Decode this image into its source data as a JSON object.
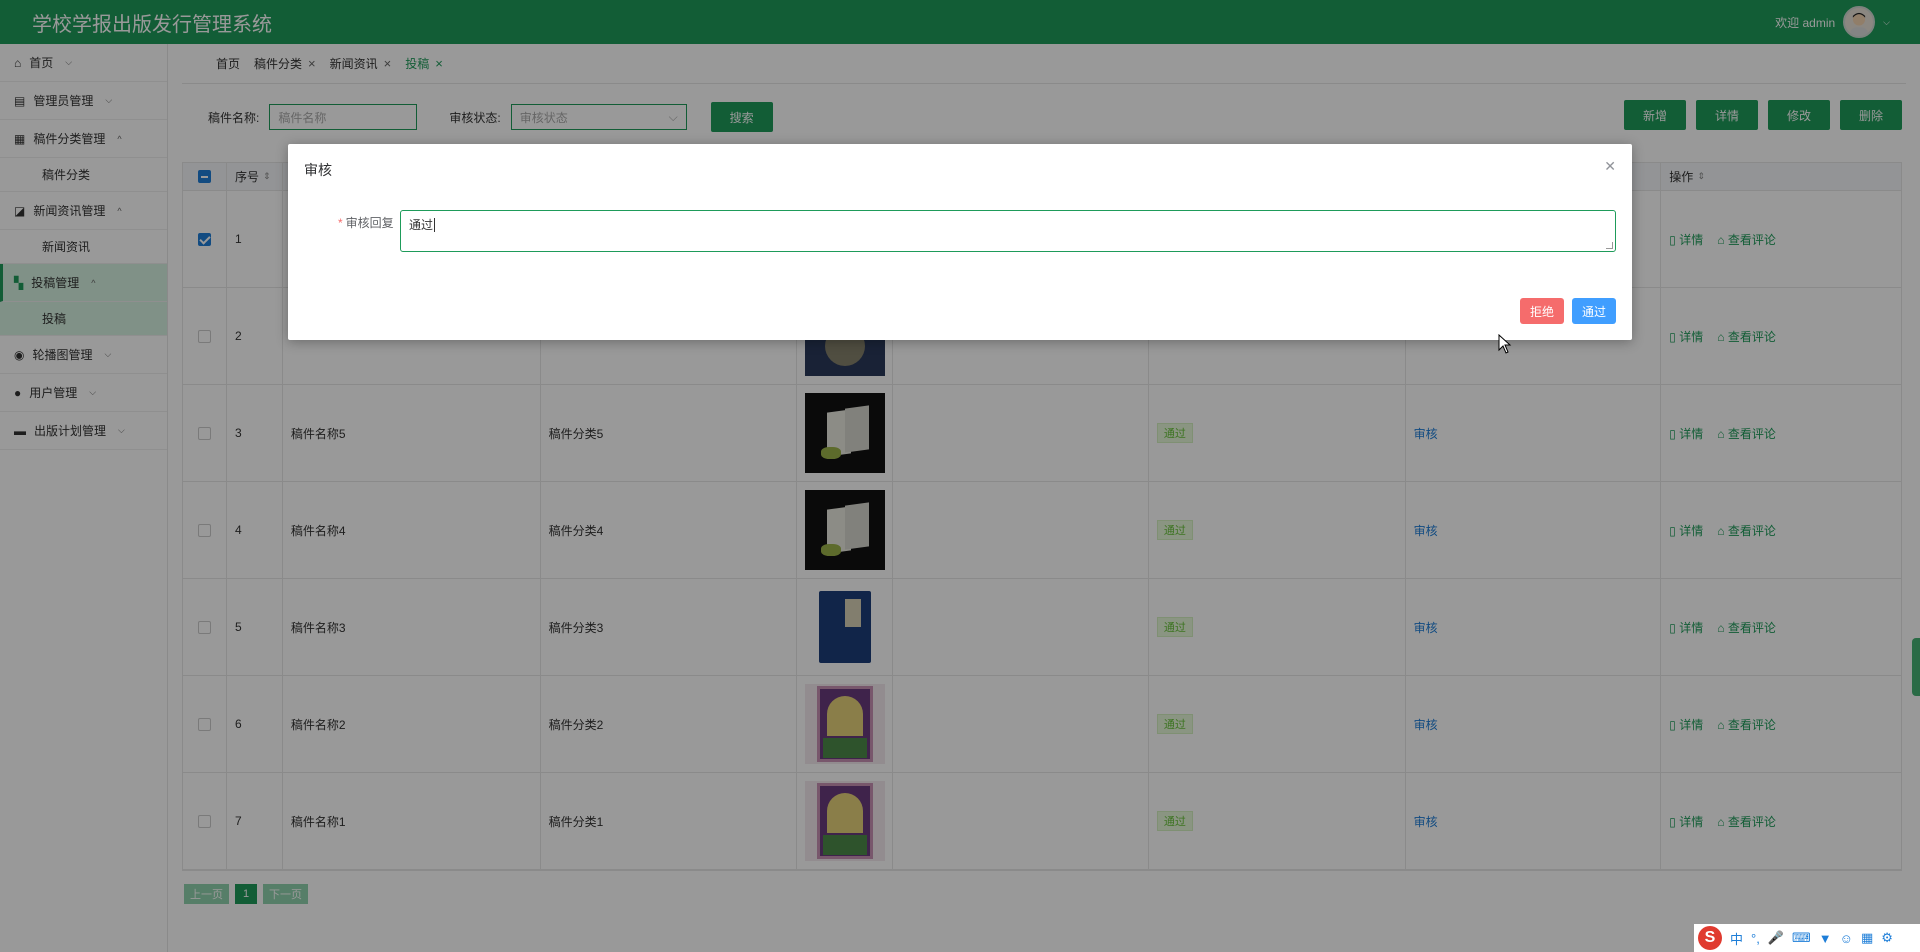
{
  "header": {
    "title": "学校学报出版发行管理系统",
    "welcome": "欢迎 admin"
  },
  "sidebar": {
    "items": [
      {
        "label": "首页",
        "icon": "home-icon"
      },
      {
        "label": "管理员管理",
        "icon": "server-icon"
      },
      {
        "label": "稿件分类管理",
        "icon": "grid-icon",
        "sub": "稿件分类"
      },
      {
        "label": "新闻资讯管理",
        "icon": "chart-icon",
        "sub": "新闻资讯"
      },
      {
        "label": "投稿管理",
        "icon": "dashboard-icon",
        "sub": "投稿"
      },
      {
        "label": "轮播图管理",
        "icon": "record-icon"
      },
      {
        "label": "用户管理",
        "icon": "user-icon"
      },
      {
        "label": "出版计划管理",
        "icon": "folder-icon"
      }
    ]
  },
  "tabs": [
    {
      "label": "首页"
    },
    {
      "label": "稿件分类"
    },
    {
      "label": "新闻资讯"
    },
    {
      "label": "投稿"
    }
  ],
  "search": {
    "name_label": "稿件名称:",
    "name_placeholder": "稿件名称",
    "status_label": "审核状态:",
    "status_placeholder": "审核状态",
    "search_button": "搜索"
  },
  "actions": {
    "add": "新增",
    "detail": "详情",
    "edit": "修改",
    "delete": "删除"
  },
  "table": {
    "headers": {
      "index": "序号",
      "ops": "操作"
    },
    "rows": [
      {
        "index": "1",
        "name": "",
        "category": "",
        "status": "",
        "audit": "",
        "detail": "详情",
        "comment": "查看评论"
      },
      {
        "index": "2",
        "name": "",
        "category": "",
        "status": "",
        "audit": "",
        "detail": "详情",
        "comment": "查看评论"
      },
      {
        "index": "3",
        "name": "稿件名称5",
        "category": "稿件分类5",
        "status": "通过",
        "audit": "审核",
        "detail": "详情",
        "comment": "查看评论"
      },
      {
        "index": "4",
        "name": "稿件名称4",
        "category": "稿件分类4",
        "status": "通过",
        "audit": "审核",
        "detail": "详情",
        "comment": "查看评论"
      },
      {
        "index": "5",
        "name": "稿件名称3",
        "category": "稿件分类3",
        "status": "通过",
        "audit": "审核",
        "detail": "详情",
        "comment": "查看评论"
      },
      {
        "index": "6",
        "name": "稿件名称2",
        "category": "稿件分类2",
        "status": "通过",
        "audit": "审核",
        "detail": "详情",
        "comment": "查看评论"
      },
      {
        "index": "7",
        "name": "稿件名称1",
        "category": "稿件分类1",
        "status": "通过",
        "audit": "审核",
        "detail": "详情",
        "comment": "查看评论"
      }
    ]
  },
  "pager": {
    "prev": "上一页",
    "current": "1",
    "next": "下一页"
  },
  "dialog": {
    "title": "审核",
    "field_label": "审核回复",
    "field_value": "通过",
    "reject": "拒绝",
    "approve": "通过"
  },
  "ime": {
    "lang": "中",
    "punct": "°,"
  },
  "colors": {
    "primary": "#1e9b5a",
    "danger": "#f56c6c",
    "info": "#409eff"
  }
}
